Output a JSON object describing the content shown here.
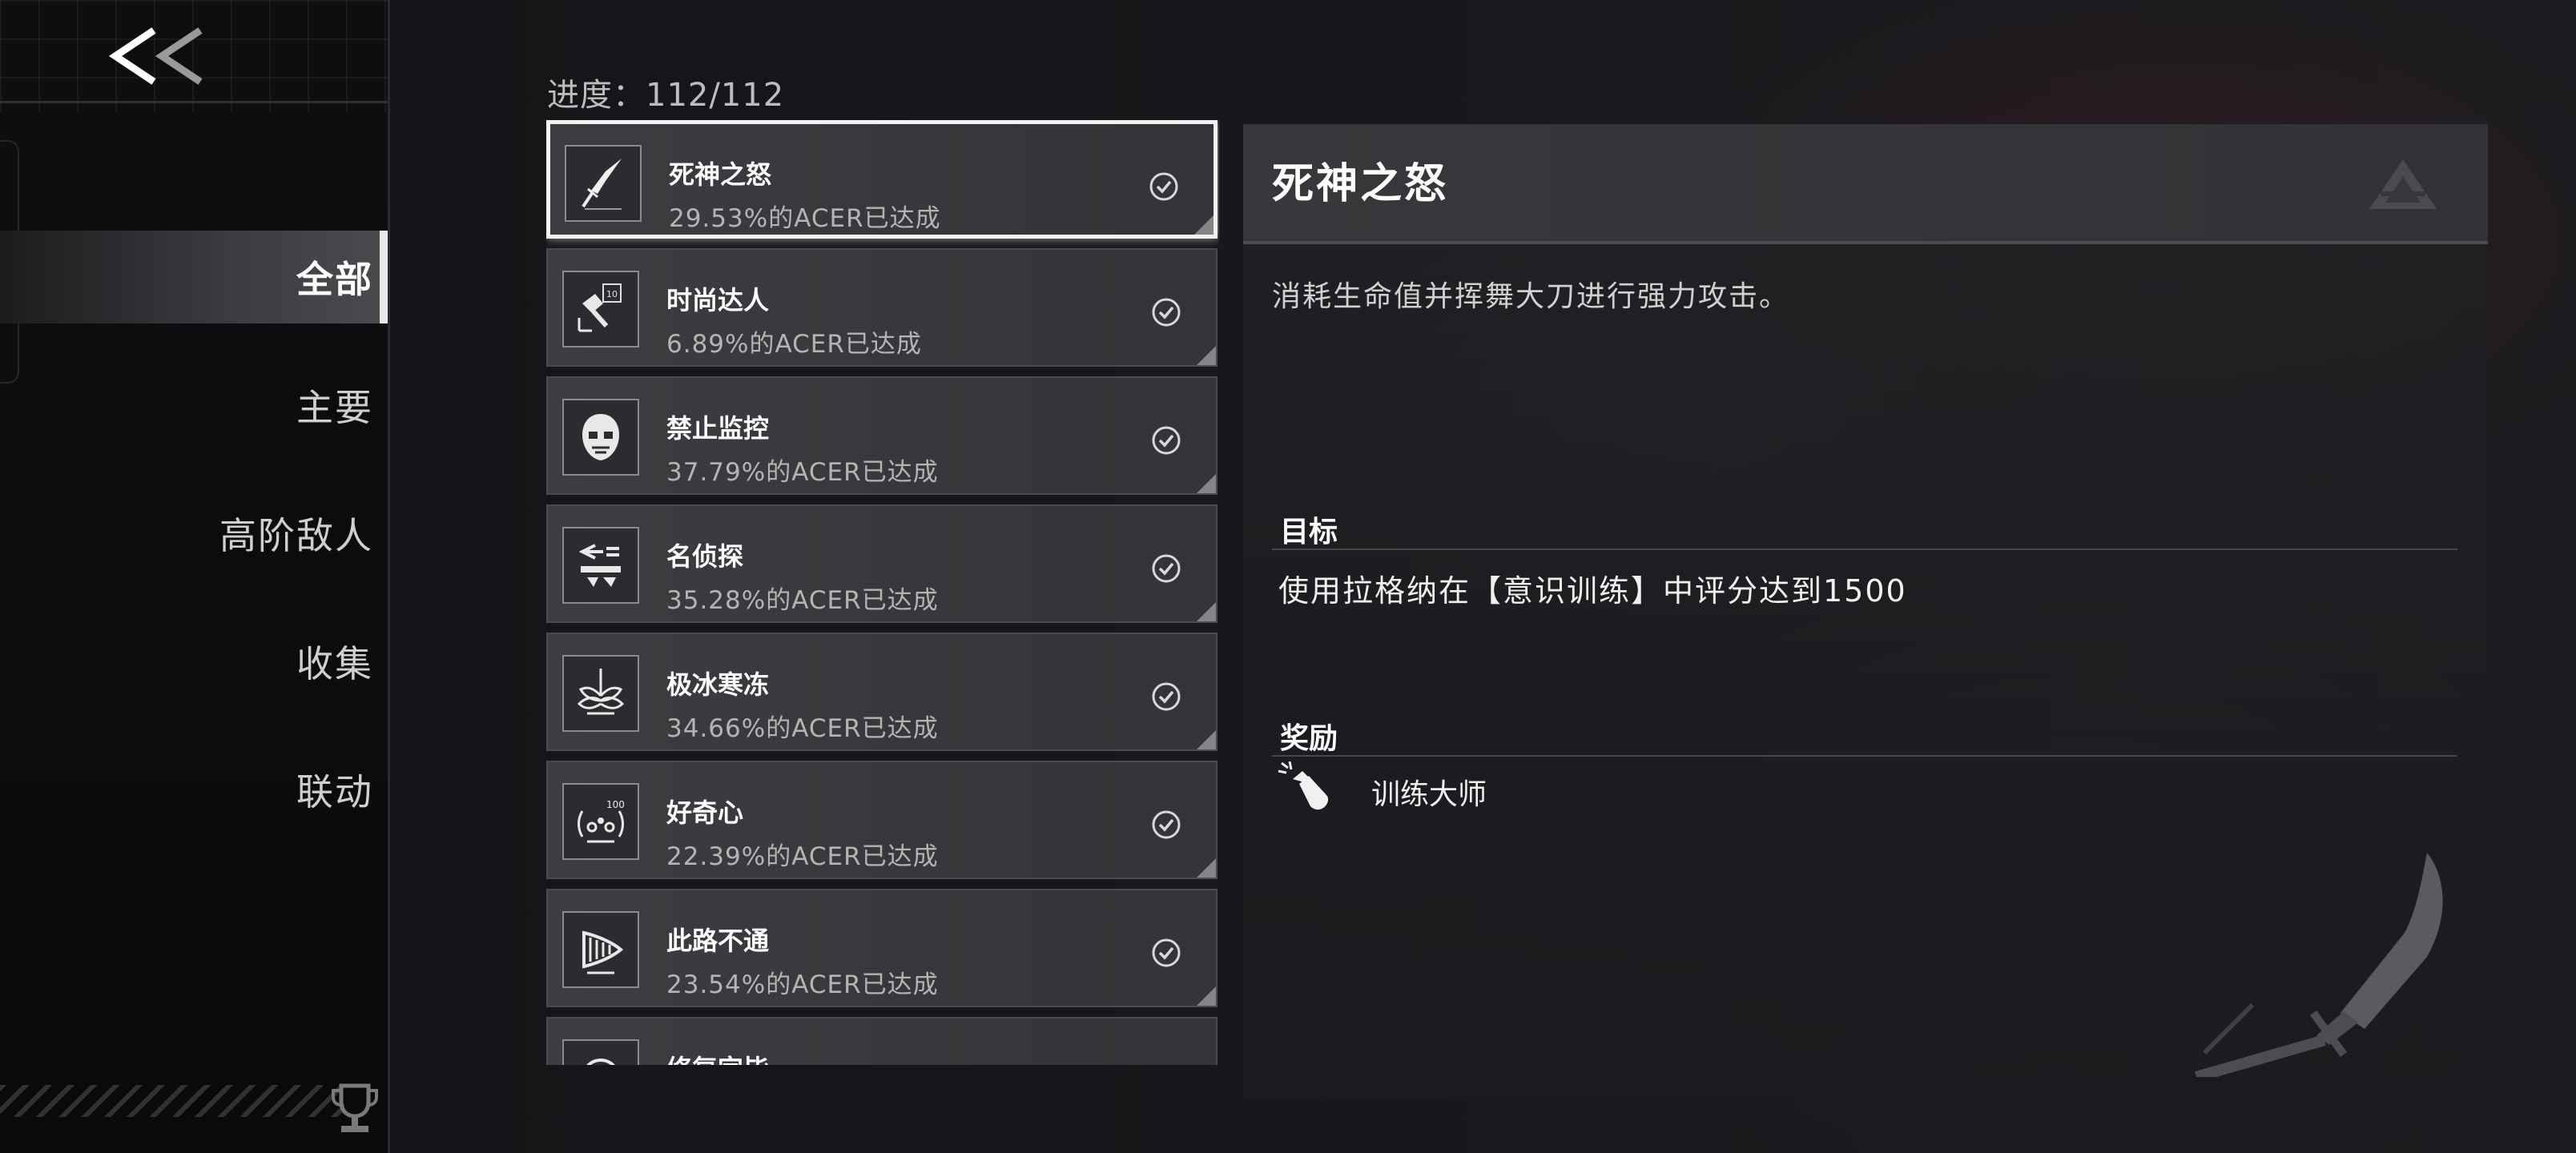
{
  "sidebar": {
    "back_label": "<<",
    "items": [
      {
        "label": "全部",
        "active": true
      },
      {
        "label": "主要",
        "active": false
      },
      {
        "label": "高阶敌人",
        "active": false
      },
      {
        "label": "收集",
        "active": false
      },
      {
        "label": "联动",
        "active": false
      }
    ],
    "footer_icon": "trophy-icon"
  },
  "list": {
    "progress": "进度：112/112",
    "achievements": [
      {
        "title": "死神之怒",
        "rate": "29.53%的ACER已达成",
        "icon": "blade-icon",
        "completed": true,
        "selected": true
      },
      {
        "title": "时尚达人",
        "rate": "6.89%的ACER已达成",
        "icon": "fashion-icon",
        "completed": true,
        "selected": false
      },
      {
        "title": "禁止监控",
        "rate": "37.79%的ACER已达成",
        "icon": "mask-icon",
        "completed": true,
        "selected": false
      },
      {
        "title": "名侦探",
        "rate": "35.28%的ACER已达成",
        "icon": "detective-icon",
        "completed": true,
        "selected": false
      },
      {
        "title": "极冰寒冻",
        "rate": "34.66%的ACER已达成",
        "icon": "ice-icon",
        "completed": true,
        "selected": false
      },
      {
        "title": "好奇心",
        "rate": "22.39%的ACER已达成",
        "icon": "curiosity-icon",
        "completed": true,
        "selected": false
      },
      {
        "title": "此路不通",
        "rate": "23.54%的ACER已达成",
        "icon": "drill-icon",
        "completed": true,
        "selected": false
      },
      {
        "title": "修复完毕",
        "rate": "",
        "icon": "repair-icon",
        "completed": true,
        "selected": false
      }
    ]
  },
  "detail": {
    "title": "死神之怒",
    "description": "消耗生命值并挥舞大刀进行强力攻击。",
    "goal_label": "目标",
    "goal_text": "使用拉格纳在【意识训练】中评分达到1500",
    "reward_label": "奖励",
    "reward_text": "训练大师",
    "reward_icon": "bottle-icon",
    "logo_icon": "logo-icon",
    "art_icon": "blade-art-icon"
  }
}
